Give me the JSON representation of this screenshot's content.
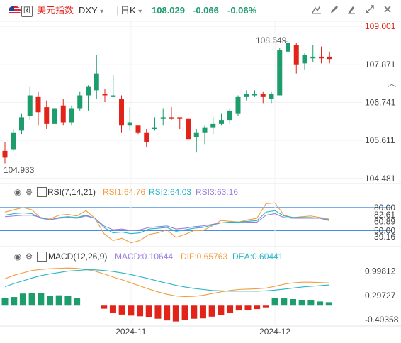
{
  "header": {
    "flag_icon": "us-flag-icon",
    "badge": "团",
    "name": "美元指数",
    "symbol": "DXY",
    "symbol_dropdown": "▾",
    "interval": "日K",
    "interval_dropdown": "▾",
    "last_price": "108.029",
    "change": "-0.066",
    "change_pct": "-0.06%",
    "colors": {
      "up": "#1d9c6c",
      "down": "#e2231a",
      "brand": "#e2231a"
    },
    "toolbar_icons": [
      "chart-type-icon",
      "draw-icon",
      "marker-icon",
      "fullscreen-icon",
      "close-icon"
    ]
  },
  "collapse_icon": "chevron-up-icon",
  "chart_data": [
    {
      "type": "candlestick",
      "colors": {
        "up": "#1d9c6c",
        "down": "#e2231a"
      },
      "y_ticks": [
        "109.001",
        "107.871",
        "106.741",
        "105.611",
        "104.481"
      ],
      "ylim": [
        104.35,
        109.15
      ],
      "x_ticks": [
        "2024-11",
        "2024-12"
      ],
      "annotations": {
        "high_label": "108.549",
        "low_label": "104.933"
      },
      "candles": [
        {
          "o": 105.3,
          "h": 105.55,
          "l": 104.93,
          "c": 105.1
        },
        {
          "o": 105.35,
          "h": 105.95,
          "l": 105.3,
          "c": 105.85
        },
        {
          "o": 105.9,
          "h": 106.4,
          "l": 105.8,
          "c": 106.3
        },
        {
          "o": 106.35,
          "h": 107.2,
          "l": 106.2,
          "c": 106.95
        },
        {
          "o": 106.9,
          "h": 107.05,
          "l": 106.05,
          "c": 106.45
        },
        {
          "o": 106.6,
          "h": 106.8,
          "l": 105.95,
          "c": 106.1
        },
        {
          "o": 106.1,
          "h": 106.65,
          "l": 106.0,
          "c": 106.55
        },
        {
          "o": 106.65,
          "h": 106.85,
          "l": 106.05,
          "c": 106.15
        },
        {
          "o": 106.15,
          "h": 106.65,
          "l": 106.05,
          "c": 106.55
        },
        {
          "o": 106.55,
          "h": 107.05,
          "l": 106.5,
          "c": 106.95
        },
        {
          "o": 106.95,
          "h": 107.25,
          "l": 106.5,
          "c": 107.2
        },
        {
          "o": 107.1,
          "h": 108.15,
          "l": 106.85,
          "c": 107.6
        },
        {
          "o": 107.0,
          "h": 107.15,
          "l": 106.75,
          "c": 106.95
        },
        {
          "o": 106.9,
          "h": 107.55,
          "l": 106.9,
          "c": 106.95
        },
        {
          "o": 106.85,
          "h": 106.95,
          "l": 105.85,
          "c": 106.05
        },
        {
          "o": 106.05,
          "h": 106.6,
          "l": 105.9,
          "c": 106.15
        },
        {
          "o": 106.05,
          "h": 106.05,
          "l": 105.8,
          "c": 105.85
        },
        {
          "o": 105.85,
          "h": 105.95,
          "l": 105.4,
          "c": 105.55
        },
        {
          "o": 105.95,
          "h": 106.3,
          "l": 105.9,
          "c": 106.0
        },
        {
          "o": 106.25,
          "h": 106.55,
          "l": 106.05,
          "c": 106.3
        },
        {
          "o": 106.3,
          "h": 106.6,
          "l": 106.2,
          "c": 106.25
        },
        {
          "o": 106.3,
          "h": 106.3,
          "l": 105.95,
          "c": 106.25
        },
        {
          "o": 106.25,
          "h": 106.35,
          "l": 105.6,
          "c": 105.65
        },
        {
          "o": 105.7,
          "h": 105.95,
          "l": 105.25,
          "c": 105.85
        },
        {
          "o": 105.85,
          "h": 106.05,
          "l": 105.5,
          "c": 106.0
        },
        {
          "o": 106.0,
          "h": 106.3,
          "l": 105.8,
          "c": 106.1
        },
        {
          "o": 106.1,
          "h": 106.4,
          "l": 106.05,
          "c": 106.2
        },
        {
          "o": 106.2,
          "h": 106.55,
          "l": 106.1,
          "c": 106.5
        },
        {
          "o": 106.4,
          "h": 106.95,
          "l": 106.35,
          "c": 106.9
        },
        {
          "o": 106.9,
          "h": 107.1,
          "l": 106.8,
          "c": 107.0
        },
        {
          "o": 106.95,
          "h": 107.1,
          "l": 106.9,
          "c": 107.0
        },
        {
          "o": 107.0,
          "h": 107.05,
          "l": 106.7,
          "c": 106.9
        },
        {
          "o": 106.85,
          "h": 107.05,
          "l": 106.7,
          "c": 107.0
        },
        {
          "o": 106.95,
          "h": 108.35,
          "l": 106.95,
          "c": 108.3
        },
        {
          "o": 108.25,
          "h": 108.55,
          "l": 108.1,
          "c": 108.5
        },
        {
          "o": 108.45,
          "h": 108.5,
          "l": 107.6,
          "c": 107.85
        },
        {
          "o": 107.9,
          "h": 108.2,
          "l": 107.7,
          "c": 108.15
        },
        {
          "o": 108.05,
          "h": 108.45,
          "l": 107.95,
          "c": 108.1
        },
        {
          "o": 108.1,
          "h": 108.4,
          "l": 107.9,
          "c": 108.05
        },
        {
          "o": 108.1,
          "h": 108.25,
          "l": 107.9,
          "c": 108.03
        }
      ]
    },
    {
      "type": "line",
      "indicator": "RSI(7,14,21)",
      "legend": [
        {
          "text": "RSI1:64.76",
          "color": "#f39c3c"
        },
        {
          "text": "RSI2:64.03",
          "color": "#26b5c7"
        },
        {
          "text": "RSI3:63.16",
          "color": "#9b7fe0"
        }
      ],
      "y_ticks": [
        "80.00",
        "82.61",
        "60.89",
        "50.00",
        "39.16"
      ],
      "ylim": [
        30,
        90
      ],
      "ref_lines": [
        80,
        50
      ],
      "ref_color": "#2f7de1",
      "series": [
        {
          "color": "#f39c3c",
          "values": [
            74,
            77,
            80,
            77,
            66,
            65,
            70,
            71,
            69,
            76,
            66,
            46,
            37,
            40,
            34,
            37,
            45,
            47,
            51,
            41,
            45,
            50,
            50,
            56,
            63,
            62,
            61,
            64,
            66,
            85,
            86,
            70,
            67,
            68,
            69,
            67,
            65
          ]
        },
        {
          "color": "#26b5c7",
          "values": [
            70,
            72,
            73,
            72,
            66,
            64,
            67,
            68,
            67,
            70,
            66,
            54,
            47,
            48,
            46,
            47,
            52,
            53,
            54,
            49,
            51,
            53,
            54,
            57,
            60,
            61,
            61,
            62,
            63,
            74,
            76,
            69,
            67,
            67,
            67,
            66,
            64
          ]
        },
        {
          "color": "#9b7fe0",
          "values": [
            68,
            69,
            70,
            70,
            67,
            64,
            66,
            67,
            66,
            69,
            66,
            56,
            51,
            52,
            50,
            51,
            54,
            55,
            56,
            52,
            53,
            55,
            56,
            58,
            60,
            60,
            60,
            61,
            61,
            70,
            72,
            67,
            66,
            66,
            66,
            66,
            63
          ]
        }
      ]
    },
    {
      "type": "bar+line",
      "indicator": "MACD(12,26,9)",
      "legend": [
        {
          "text": "MACD:0.10644",
          "color": "#9b7fe0"
        },
        {
          "text": "DIF:0.65763",
          "color": "#f39c3c"
        },
        {
          "text": "DEA:0.60441",
          "color": "#26b5c7"
        }
      ],
      "y_ticks": [
        "0.99812",
        "0.29727",
        "-0.40358"
      ],
      "ylim": [
        -0.55,
        1.3
      ],
      "x_ticks": [
        "2024-11",
        "2024-12"
      ],
      "histogram": [
        0.23,
        0.25,
        0.35,
        0.37,
        0.37,
        0.28,
        0.3,
        0.29,
        0.22,
        0,
        0,
        -0.09,
        -0.2,
        -0.26,
        -0.29,
        -0.31,
        -0.34,
        -0.38,
        -0.43,
        -0.46,
        -0.42,
        -0.38,
        -0.37,
        -0.32,
        -0.27,
        -0.22,
        -0.14,
        -0.12,
        -0.1,
        -0.05,
        0.22,
        0.21,
        0.19,
        0.16,
        0.15,
        0.12,
        0.1
      ],
      "series": [
        {
          "name": "DIF",
          "color": "#f39c3c",
          "values": [
            0.78,
            0.88,
            0.95,
            1.02,
            1.05,
            1.07,
            1.08,
            1.09,
            1.08,
            1.05,
            1.0,
            0.92,
            0.83,
            0.75,
            0.66,
            0.57,
            0.48,
            0.4,
            0.33,
            0.28,
            0.26,
            0.27,
            0.3,
            0.35,
            0.4,
            0.44,
            0.47,
            0.48,
            0.49,
            0.51,
            0.56,
            0.62,
            0.66,
            0.68,
            0.68,
            0.67,
            0.66
          ]
        },
        {
          "name": "DEA",
          "color": "#26b5c7",
          "values": [
            0.55,
            0.64,
            0.72,
            0.8,
            0.87,
            0.92,
            0.96,
            1.0,
            1.02,
            1.04,
            1.04,
            1.02,
            0.99,
            0.95,
            0.9,
            0.84,
            0.78,
            0.71,
            0.65,
            0.59,
            0.54,
            0.5,
            0.47,
            0.44,
            0.43,
            0.42,
            0.42,
            0.42,
            0.42,
            0.43,
            0.45,
            0.48,
            0.51,
            0.54,
            0.56,
            0.58,
            0.6
          ]
        }
      ]
    }
  ]
}
